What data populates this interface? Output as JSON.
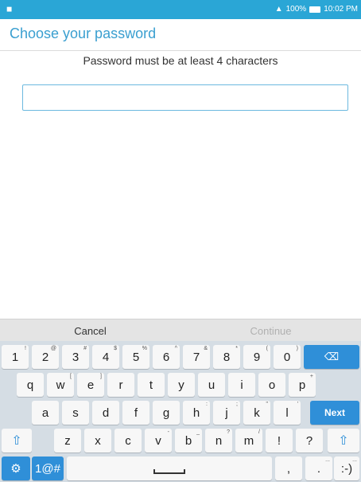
{
  "status": {
    "signal_icon": "wifi-icon",
    "battery": "100%",
    "time": "10:02 PM"
  },
  "header": {
    "title": "Choose your password"
  },
  "message": "Password must be at least 4 characters",
  "password_field": {
    "value": ""
  },
  "actions": {
    "cancel": "Cancel",
    "continue": "Continue"
  },
  "keyboard": {
    "row1": [
      {
        "label": "1",
        "hint": "!"
      },
      {
        "label": "2",
        "hint": "@"
      },
      {
        "label": "3",
        "hint": "#"
      },
      {
        "label": "4",
        "hint": "$"
      },
      {
        "label": "5",
        "hint": "%"
      },
      {
        "label": "6",
        "hint": "^"
      },
      {
        "label": "7",
        "hint": "&"
      },
      {
        "label": "8",
        "hint": "*"
      },
      {
        "label": "9",
        "hint": "("
      },
      {
        "label": "0",
        "hint": ")"
      }
    ],
    "row2": [
      {
        "label": "q",
        "hint": ""
      },
      {
        "label": "w",
        "hint": "["
      },
      {
        "label": "e",
        "hint": "]"
      },
      {
        "label": "r",
        "hint": ""
      },
      {
        "label": "t",
        "hint": ""
      },
      {
        "label": "y",
        "hint": ""
      },
      {
        "label": "u",
        "hint": ""
      },
      {
        "label": "i",
        "hint": ""
      },
      {
        "label": "o",
        "hint": ""
      },
      {
        "label": "p",
        "hint": "+"
      }
    ],
    "row3": [
      {
        "label": "a",
        "hint": ""
      },
      {
        "label": "s",
        "hint": ""
      },
      {
        "label": "d",
        "hint": ""
      },
      {
        "label": "f",
        "hint": ""
      },
      {
        "label": "g",
        "hint": ""
      },
      {
        "label": "h",
        "hint": ":"
      },
      {
        "label": "j",
        "hint": ";"
      },
      {
        "label": "k",
        "hint": "\""
      },
      {
        "label": "l",
        "hint": "'"
      }
    ],
    "row4": [
      {
        "label": "z",
        "hint": ""
      },
      {
        "label": "x",
        "hint": ""
      },
      {
        "label": "c",
        "hint": ""
      },
      {
        "label": "v",
        "hint": "-"
      },
      {
        "label": "b",
        "hint": "_"
      },
      {
        "label": "n",
        "hint": "?"
      },
      {
        "label": "m",
        "hint": "/"
      },
      {
        "label": "!",
        "hint": ""
      },
      {
        "label": "?",
        "hint": ""
      }
    ],
    "next": "Next",
    "symbols": "1@#",
    "comma": ",",
    "period": ".",
    "smiley": ":-)",
    "backspace_icon": "backspace-icon",
    "shift_icon": "shift-icon",
    "settings_icon": "gear-icon",
    "space_icon": "space-icon"
  }
}
